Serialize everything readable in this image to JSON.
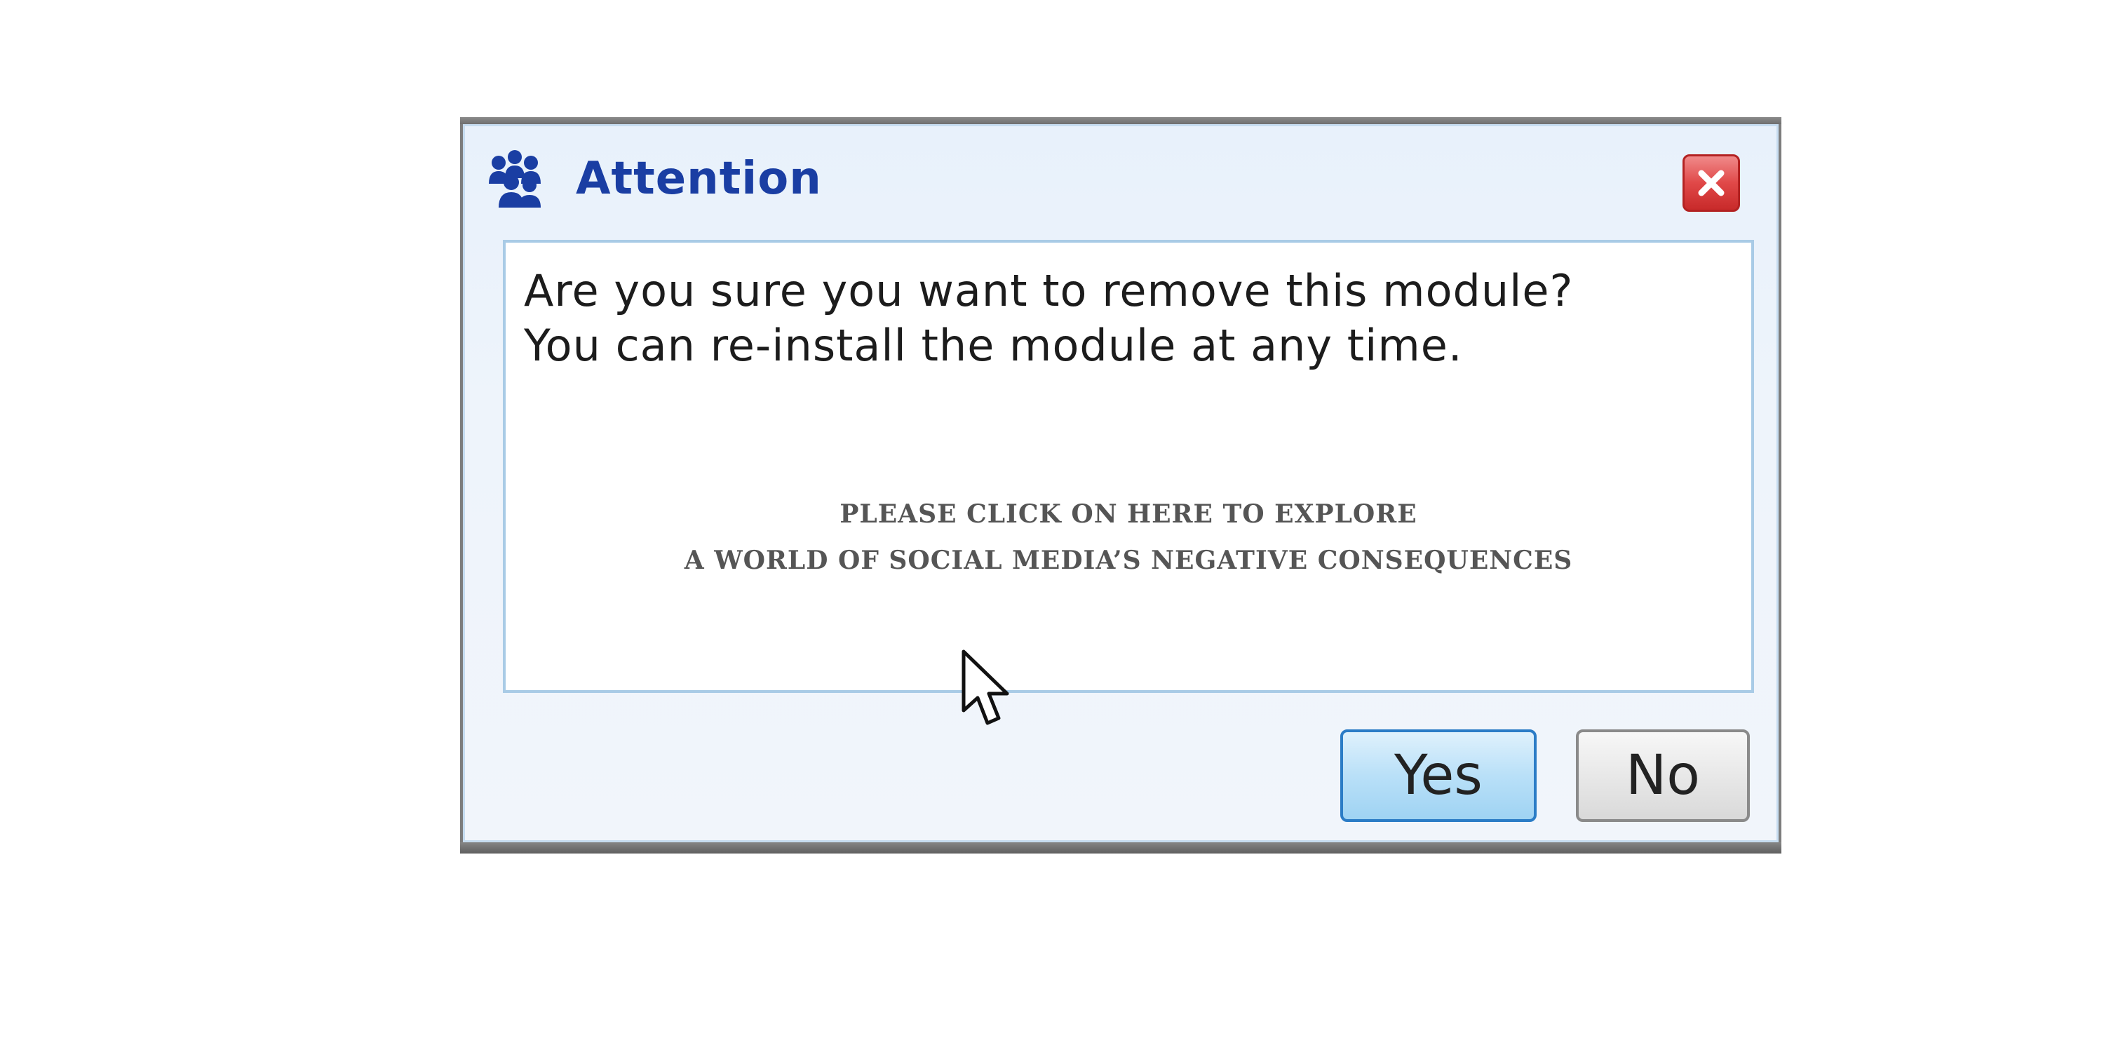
{
  "dialog": {
    "title": "Attention",
    "title_icon": "users-group-icon",
    "close_icon": "close-icon",
    "message_line1": "Are you sure you want to remove this module?",
    "message_line2": "You can re-install the module at any time.",
    "explore_line1": "PLEASE CLICK ON HERE TO EXPLORE",
    "explore_line2": "A WORLD OF SOCIAL MEDIA’S NEGATIVE CONSEQUENCES",
    "yes_label": "Yes",
    "no_label": "No"
  },
  "colors": {
    "title": "#1a3ea3",
    "close_button": "#e04848",
    "yes_border": "#2b7cc6",
    "no_border": "#8a8a8a"
  }
}
